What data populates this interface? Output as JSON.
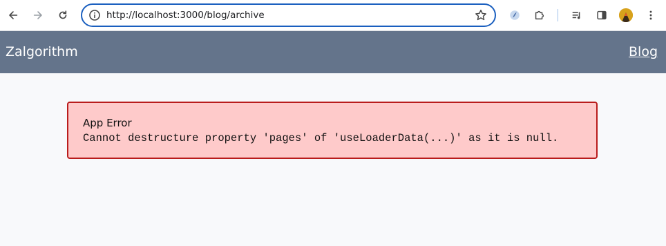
{
  "browser": {
    "url": "http://localhost:3000/blog/archive",
    "icons": [
      "back-arrow",
      "forward-arrow",
      "reload",
      "site-info",
      "bookmark-star",
      "extension-quick-ui",
      "extensions-puzzle",
      "media-controls",
      "side-panel",
      "profile-avatar",
      "kebab-menu"
    ]
  },
  "header": {
    "brand": "Zalgorithm",
    "nav_link": "Blog",
    "background": "#64748b"
  },
  "error": {
    "title": "App Error",
    "message": "Cannot destructure property 'pages' of 'useLoaderData(...)' as it is null.",
    "background": "#fecaca",
    "border": "#b91c1c"
  }
}
